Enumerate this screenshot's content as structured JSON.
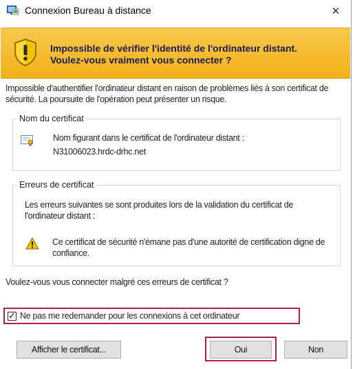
{
  "window": {
    "title": "Connexion Bureau à distance",
    "close_glyph": "✕",
    "icon": "remote-desktop-icon"
  },
  "banner": {
    "line1": "Impossible de vérifier l'identité de l'ordinateur distant.",
    "line2": "Voulez-vous vraiment vous connecter ?",
    "icon": "security-shield-warning-icon",
    "color": "#f4b11a"
  },
  "intro": "Impossible d'authentifier l'ordinateur distant en raison de problèmes liés à son certificat de sécurité. La poursuite de l'opération peut présenter un risque.",
  "certificate": {
    "group_label": "Nom du certificat",
    "label": "Nom figurant dans le certificat de l'ordinateur distant :",
    "value": "N31006023.hrdc-drhc.net",
    "icon": "certificate-icon"
  },
  "errors": {
    "group_label": "Erreurs de certificat",
    "intro": "Les erreurs suivantes se sont produites lors de la validation du certificat de l'ordinateur distant :",
    "items": [
      {
        "text": "Ce certificat de sécurité n'émane pas d'une autorité de certification digne de confiance.",
        "icon": "warning-icon"
      }
    ]
  },
  "question": "Voulez-vous vous connecter malgré ces erreurs de certificat ?",
  "checkbox": {
    "label": "Ne pas me redemander pour les connexions à cet ordinateur",
    "checked": true,
    "check_glyph": "✓"
  },
  "buttons": {
    "view_certificate": "Afficher le certificat...",
    "yes": "Oui",
    "no": "Non"
  },
  "highlight_color": "#b01e4a"
}
